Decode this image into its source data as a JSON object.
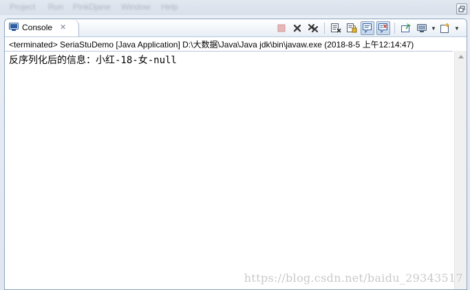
{
  "menubar": {
    "items": [
      "Project",
      "Run",
      "PinkDjane",
      "Window",
      "Help"
    ]
  },
  "console_view": {
    "tab_label": "Console",
    "tab_close_glyph": "✕",
    "process_description": "<terminated> SeriaStuDemo [Java Application] D:\\大数据\\Java\\Java jdk\\bin\\javaw.exe (2018-8-5 上午12:14:47)",
    "output_lines": [
      "反序列化后的信息：小红-18-女-null"
    ]
  },
  "toolbar": {
    "icons": [
      "terminate-icon",
      "remove-launch-icon",
      "remove-all-terminated-icon",
      "clear-console-icon",
      "scroll-lock-icon",
      "show-on-stdout-icon",
      "show-on-stderr-icon",
      "pin-console-icon",
      "display-console-icon",
      "open-console-icon"
    ]
  },
  "watermark": {
    "text": "https://blog.csdn.net/baidu_29343517"
  },
  "colors": {
    "view_border": "#8ea2bd",
    "terminate_red": "#c0504d",
    "accent_blue": "#2f5e9e",
    "watermark": "#c9c9c9"
  }
}
